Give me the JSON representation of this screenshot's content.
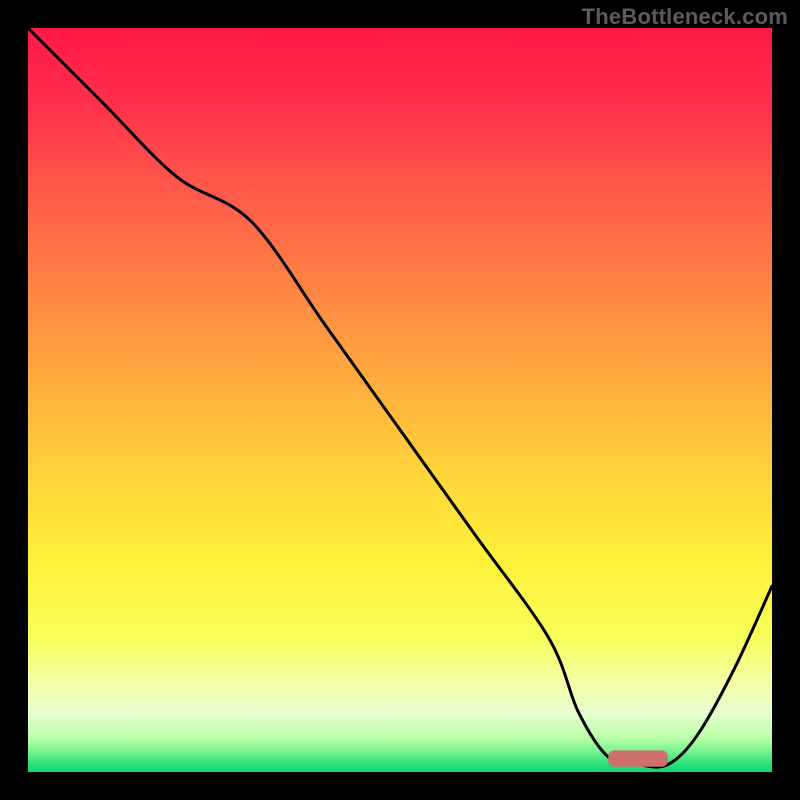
{
  "watermark": "TheBottleneck.com",
  "chart_data": {
    "type": "line",
    "title": "",
    "xlabel": "",
    "ylabel": "",
    "xlim": [
      0,
      100
    ],
    "ylim": [
      0,
      100
    ],
    "grid": false,
    "series": [
      {
        "name": "bottleneck-curve",
        "color": "#000000",
        "x": [
          0,
          10,
          20,
          30,
          40,
          50,
          60,
          70,
          74,
          78,
          82,
          86,
          90,
          95,
          100
        ],
        "y": [
          100,
          90,
          80,
          74,
          60,
          46,
          32,
          18,
          8,
          2,
          1,
          1,
          5,
          14,
          25
        ]
      }
    ],
    "marker": {
      "name": "optimal-range",
      "color": "#cf7070",
      "x_start": 78,
      "x_end": 86,
      "y": 0.7,
      "height": 2.2
    },
    "background_gradient": {
      "type": "vertical",
      "stops": [
        {
          "pos": 0.0,
          "color": "#ff1846"
        },
        {
          "pos": 0.1,
          "color": "#ff2f4b"
        },
        {
          "pos": 0.22,
          "color": "#ff5a4a"
        },
        {
          "pos": 0.35,
          "color": "#ff8444"
        },
        {
          "pos": 0.48,
          "color": "#ffae3e"
        },
        {
          "pos": 0.6,
          "color": "#ffd43a"
        },
        {
          "pos": 0.72,
          "color": "#fff23a"
        },
        {
          "pos": 0.82,
          "color": "#f8ff5a"
        },
        {
          "pos": 0.88,
          "color": "#f4ffa6"
        },
        {
          "pos": 0.92,
          "color": "#e8ffd0"
        },
        {
          "pos": 0.955,
          "color": "#b7ffa6"
        },
        {
          "pos": 0.975,
          "color": "#6cf08a"
        },
        {
          "pos": 0.99,
          "color": "#27de7a"
        },
        {
          "pos": 1.0,
          "color": "#12d873"
        }
      ]
    }
  }
}
